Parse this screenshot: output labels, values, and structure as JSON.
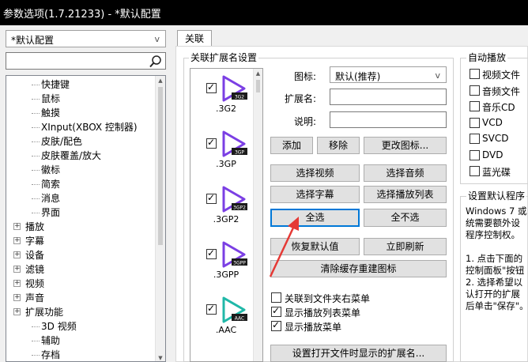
{
  "window": {
    "title": "参数选项(1.7.21233) - *默认配置"
  },
  "profile_select": {
    "value": "*默认配置",
    "arrow": "v"
  },
  "search": {
    "value": "",
    "icon": "search-icon"
  },
  "tree": {
    "items": [
      {
        "label": "快捷键",
        "expander": ""
      },
      {
        "label": "鼠标",
        "expander": ""
      },
      {
        "label": "触摸",
        "expander": ""
      },
      {
        "label": "XInput(XBOX 控制器)",
        "expander": ""
      },
      {
        "label": "皮肤/配色",
        "expander": ""
      },
      {
        "label": "皮肤覆盖/放大",
        "expander": ""
      },
      {
        "label": "徽标",
        "expander": ""
      },
      {
        "label": "简索",
        "expander": ""
      },
      {
        "label": "消息",
        "expander": ""
      },
      {
        "label": "界面",
        "expander": ""
      },
      {
        "label": "播放",
        "expander": "+"
      },
      {
        "label": "字幕",
        "expander": "+"
      },
      {
        "label": "设备",
        "expander": "+"
      },
      {
        "label": "滤镜",
        "expander": "+"
      },
      {
        "label": "视频",
        "expander": "+"
      },
      {
        "label": "声音",
        "expander": "+"
      },
      {
        "label": "扩展功能",
        "expander": "+"
      },
      {
        "label": "3D 视频",
        "expander": ""
      },
      {
        "label": "辅助",
        "expander": ""
      },
      {
        "label": "存档",
        "expander": ""
      }
    ]
  },
  "tabs": [
    {
      "label": "关联"
    }
  ],
  "assoc": {
    "group_title": "关联扩展名设置",
    "extensions": [
      {
        "name": ".3G2",
        "badge": "3G2",
        "checked": true,
        "color": "#7b3fe4"
      },
      {
        "name": ".3GP",
        "badge": "3GP",
        "checked": true,
        "color": "#7b3fe4"
      },
      {
        "name": ".3GP2",
        "badge": "3GP2",
        "checked": true,
        "color": "#7b3fe4"
      },
      {
        "name": ".3GPP",
        "badge": "3GPP",
        "checked": true,
        "color": "#7b3fe4"
      },
      {
        "name": ".AAC",
        "badge": "AAC",
        "checked": true,
        "color": "#20b8a8"
      }
    ],
    "icon_label": "图标:",
    "icon_value": "默认(推荐)",
    "icon_arrow": "v",
    "ext_label": "扩展名:",
    "desc_label": "说明:",
    "buttons": {
      "add": "添加",
      "remove": "移除",
      "change_icon": "更改图标...",
      "select_video": "选择视频",
      "select_audio": "选择音频",
      "select_subtitle": "选择字幕",
      "select_playlist": "选择播放列表",
      "select_all": "全选",
      "select_none": "全不选",
      "restore_default": "恢复默认值",
      "refresh_now": "立即刷新",
      "clear_cache": "清除缓存重建图标",
      "set_open_ext": "设置打开文件时显示的扩展名..."
    },
    "options": [
      {
        "label": "关联到文件夹右菜单",
        "checked": false
      },
      {
        "label": "显示播放列表菜单",
        "checked": true
      },
      {
        "label": "显示播放菜单",
        "checked": true
      }
    ]
  },
  "autoplay": {
    "title": "自动播放",
    "items": [
      {
        "label": "视频文件",
        "checked": false
      },
      {
        "label": "音频文件",
        "checked": false
      },
      {
        "label": "音乐CD",
        "checked": false
      },
      {
        "label": "VCD",
        "checked": false
      },
      {
        "label": "SVCD",
        "checked": false
      },
      {
        "label": "DVD",
        "checked": false
      },
      {
        "label": "蓝光碟",
        "checked": false
      }
    ]
  },
  "default_program": {
    "title": "设置默认程序",
    "lines": [
      "Windows 7 或以",
      "统需要额外设",
      "程序控制权。",
      "",
      "1. 点击下面的",
      "控制面板\"按钮",
      "2. 选择希望以",
      "认打开的扩展",
      "后单击\"保存\"。"
    ]
  },
  "colors": {
    "accent": "#0078d7",
    "annotation_arrow": "#e53935"
  }
}
